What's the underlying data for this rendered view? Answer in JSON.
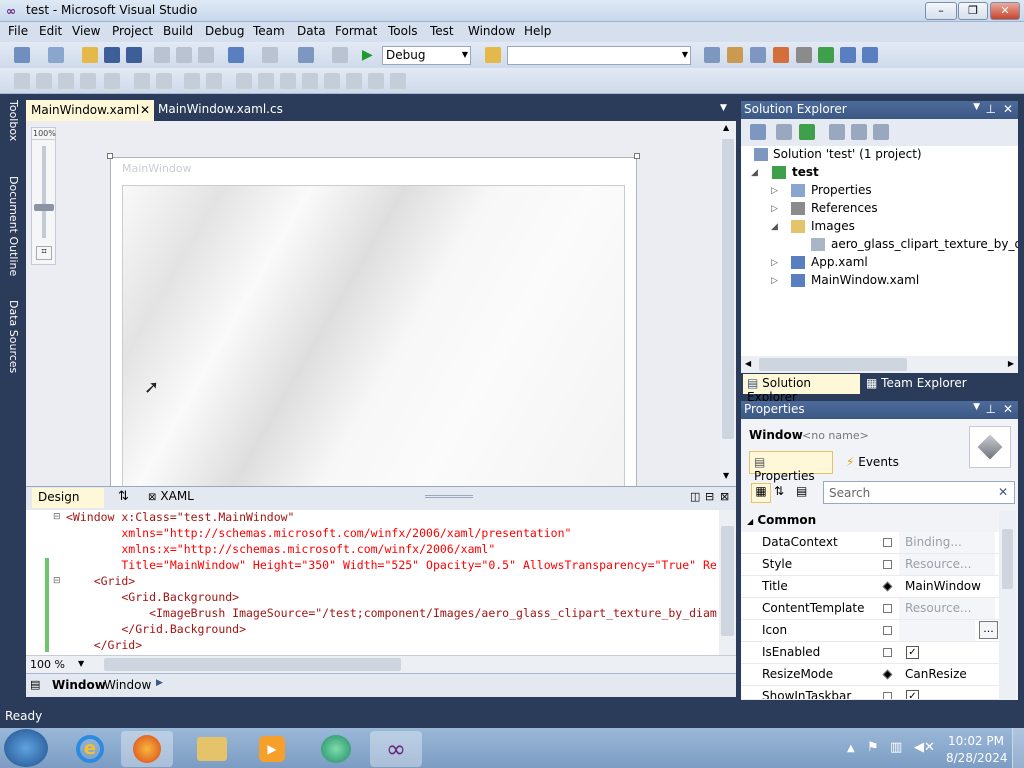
{
  "window": {
    "title": "test - Microsoft Visual Studio",
    "minimize": "–",
    "maximize": "❐",
    "close": "✕"
  },
  "menu": [
    "File",
    "Edit",
    "View",
    "Project",
    "Build",
    "Debug",
    "Team",
    "Data",
    "Format",
    "Tools",
    "Test",
    "Window",
    "Help"
  ],
  "toolbar": {
    "config_value": "Debug",
    "platform_value": ""
  },
  "left_tabs": [
    "Toolbox",
    "Document Outline",
    "Data Sources"
  ],
  "editor_tabs": [
    {
      "label": "MainWindow.xaml",
      "active": true
    },
    {
      "label": "MainWindow.xaml.cs",
      "active": false
    }
  ],
  "designer": {
    "zoom_label": "100%",
    "window_title": "MainWindow"
  },
  "split_tabs": {
    "design": "Design",
    "swap": "⇅",
    "xaml": "XAML"
  },
  "code_lines": [
    {
      "t": "<Window x:Class=\"test.MainWindow\""
    },
    {
      "t": "        xmlns=\"http://schemas.microsoft.com/winfx/2006/xaml/presentation\""
    },
    {
      "t": "        xmlns:x=\"http://schemas.microsoft.com/winfx/2006/xaml\""
    },
    {
      "t": "        Title=\"MainWindow\" Height=\"350\" Width=\"525\" Opacity=\"0.5\" AllowsTransparency=\"True\" Re"
    },
    {
      "t": "    <Grid>"
    },
    {
      "t": "        <Grid.Background>"
    },
    {
      "t": "            <ImageBrush ImageSource=\"/test;component/Images/aero_glass_clipart_texture_by_diam"
    },
    {
      "t": "        </Grid.Background>"
    },
    {
      "t": "    </Grid>"
    }
  ],
  "code_zoom": "100 %",
  "breadcrumb": {
    "item1": "Window",
    "item2": "Window"
  },
  "solution_explorer": {
    "title": "Solution Explorer",
    "items": [
      {
        "label": "Solution 'test' (1 project)",
        "arrow": ""
      },
      {
        "label": "test",
        "arrow": "◢"
      },
      {
        "label": "Properties",
        "arrow": "▷"
      },
      {
        "label": "References",
        "arrow": "▷"
      },
      {
        "label": "Images",
        "arrow": "◢"
      },
      {
        "label": "aero_glass_clipart_texture_by_diamo",
        "arrow": ""
      },
      {
        "label": "App.xaml",
        "arrow": "▷"
      },
      {
        "label": "MainWindow.xaml",
        "arrow": "▷"
      }
    ],
    "tab_solution": "Solution Explorer",
    "tab_team": "Team Explorer"
  },
  "properties": {
    "title": "Properties",
    "object_type": "Window",
    "object_name": "<no name>",
    "tab_properties": "Properties",
    "tab_events": "Events",
    "search_placeholder": "Search",
    "category": "Common",
    "rows": [
      {
        "name": "DataContext",
        "value": "Binding...",
        "placeholder": true,
        "marker": "empty"
      },
      {
        "name": "Style",
        "value": "Resource...",
        "placeholder": true,
        "marker": "empty"
      },
      {
        "name": "Title",
        "value": "MainWindow",
        "placeholder": false,
        "marker": "filled"
      },
      {
        "name": "ContentTemplate",
        "value": "Resource...",
        "placeholder": true,
        "marker": "empty"
      },
      {
        "name": "Icon",
        "value": "",
        "placeholder": false,
        "marker": "empty",
        "button": "..."
      },
      {
        "name": "IsEnabled",
        "value": "✓",
        "checkbox": true,
        "marker": "empty"
      },
      {
        "name": "ResizeMode",
        "value": "CanResize",
        "placeholder": false,
        "marker": "filled"
      },
      {
        "name": "ShowInTaskbar",
        "value": "✓",
        "checkbox": true,
        "marker": "empty"
      }
    ]
  },
  "status": {
    "text": "Ready"
  },
  "taskbar": {
    "time": "10:02 PM",
    "date": "8/28/2024"
  }
}
